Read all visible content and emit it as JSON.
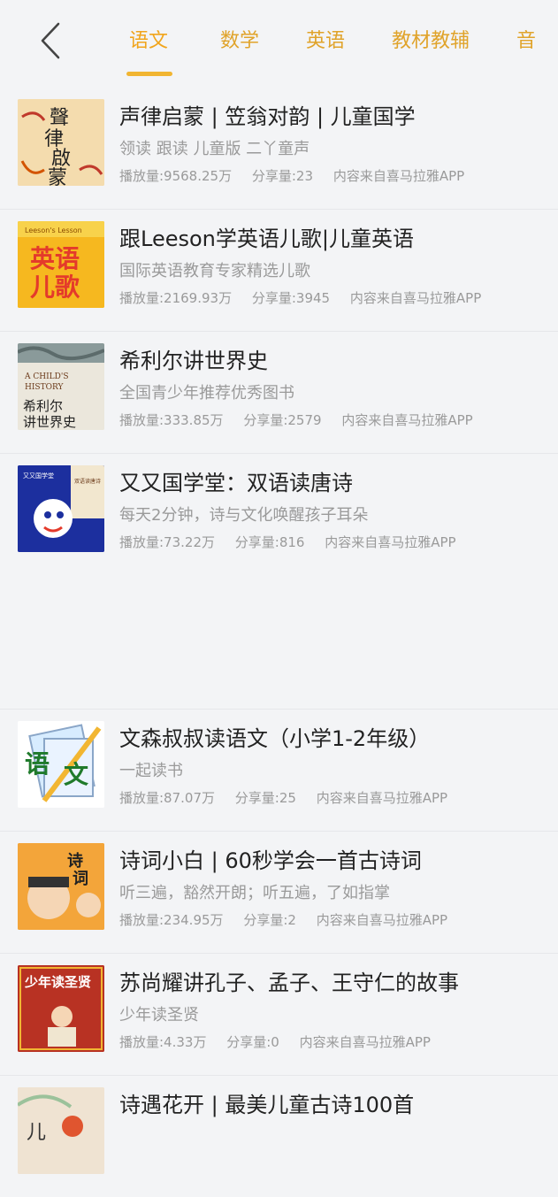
{
  "header": {
    "back_icon": "chevron-left-icon",
    "tabs": [
      {
        "label": "语文",
        "active": true
      },
      {
        "label": "数学"
      },
      {
        "label": "英语"
      },
      {
        "label": "教材教辅"
      },
      {
        "label": "音"
      }
    ]
  },
  "items": [
    {
      "title": "声律启蒙 | 笠翁对韵 | 儿童国学",
      "subtitle": "领读 跟读 儿童版 二丫童声",
      "plays": "播放量:9568.25万",
      "shares": "分享量:23",
      "source": "内容来自喜马拉雅APP",
      "cover_text": [
        "聲",
        "律",
        "啟",
        "蒙"
      ]
    },
    {
      "title": "跟Leeson学英语儿歌|儿童英语",
      "subtitle": "国际英语教育专家精选儿歌",
      "plays": "播放量:2169.93万",
      "shares": "分享量:3945",
      "source": "内容来自喜马拉雅APP",
      "cover_text": [
        "Leeson's Lesson",
        "英语",
        "儿歌"
      ]
    },
    {
      "title": "希利尔讲世界史",
      "subtitle": "全国青少年推荐优秀图书",
      "plays": "播放量:333.85万",
      "shares": "分享量:2579",
      "source": "内容来自喜马拉雅APP",
      "cover_text": [
        "A CHILD'S",
        "HISTORY",
        "希利尔",
        "讲世界史"
      ]
    },
    {
      "title": "又又国学堂：双语读唐诗",
      "subtitle": "每天2分钟，诗与文化唤醒孩子耳朵",
      "plays": "播放量:73.22万",
      "shares": "分享量:816",
      "source": "内容来自喜马拉雅APP",
      "cover_text": [
        "又又国学堂",
        "双语读唐诗"
      ]
    },
    {
      "title": "文森叔叔读语文（小学1-2年级）",
      "subtitle": "一起读书",
      "plays": "播放量:87.07万",
      "shares": "分享量:25",
      "source": "内容来自喜马拉雅APP",
      "cover_text": [
        "语",
        "文"
      ]
    },
    {
      "title": "诗词小白 | 60秒学会一首古诗词",
      "subtitle": "听三遍，豁然开朗；听五遍，了如指掌",
      "plays": "播放量:234.95万",
      "shares": "分享量:2",
      "source": "内容来自喜马拉雅APP",
      "cover_text": [
        "诗",
        "词"
      ]
    },
    {
      "title": "苏尚耀讲孔子、孟子、王守仁的故事",
      "subtitle": "少年读圣贤",
      "plays": "播放量:4.33万",
      "shares": "分享量:0",
      "source": "内容来自喜马拉雅APP",
      "cover_text": [
        "少年读圣贤"
      ]
    },
    {
      "title": "诗遇花开 | 最美儿童古诗100首",
      "cover_text": [
        "儿"
      ]
    }
  ],
  "colors": {
    "accent": "#f1a51c",
    "background": "#f3f4f6"
  }
}
